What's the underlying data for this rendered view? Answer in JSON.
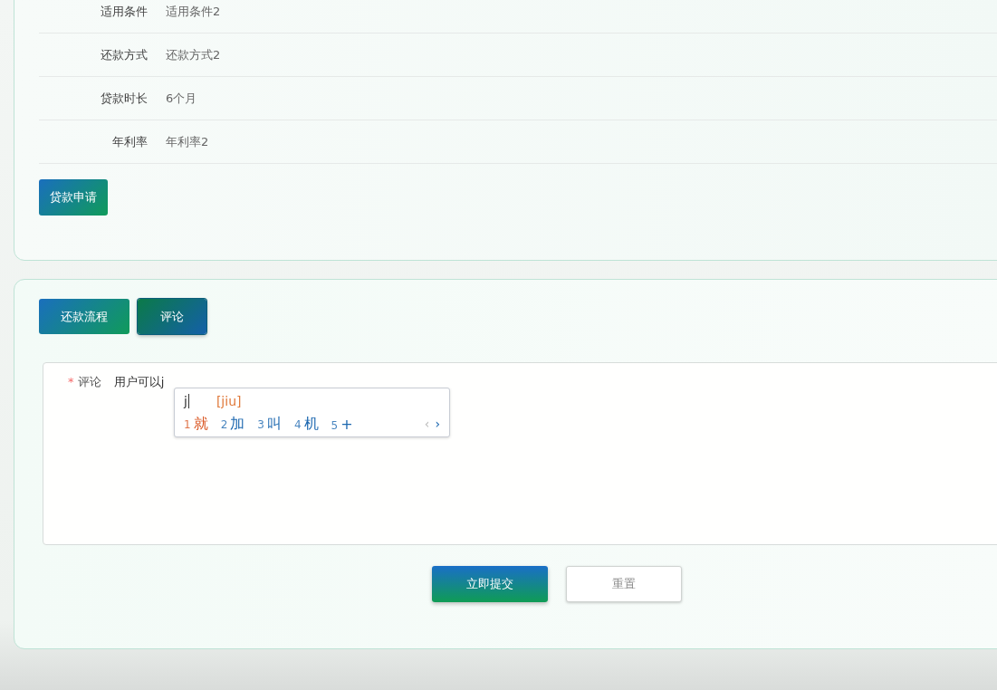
{
  "details": [
    {
      "label": "适用条件",
      "value": "适用条件2"
    },
    {
      "label": "还款方式",
      "value": "还款方式2"
    },
    {
      "label": "贷款时长",
      "value": "6个月"
    },
    {
      "label": "年利率",
      "value": "年利率2"
    }
  ],
  "apply_button": "贷款申请",
  "tabs": [
    {
      "label": "还款流程",
      "selected": false
    },
    {
      "label": "评论",
      "selected": true
    }
  ],
  "comment_form": {
    "label": "评论",
    "required_mark": "*",
    "value": "用户可以j"
  },
  "ime_popup": {
    "composition": "j",
    "pinyin": "[jiu]",
    "candidates": [
      {
        "number": "1",
        "text": "就",
        "selected": true
      },
      {
        "number": "2",
        "text": "加",
        "selected": false
      },
      {
        "number": "3",
        "text": "叫",
        "selected": false
      },
      {
        "number": "4",
        "text": "机",
        "selected": false
      },
      {
        "number": "5",
        "text": "+",
        "selected": false
      }
    ],
    "prev": "‹",
    "next": "›"
  },
  "buttons": {
    "submit": "立即提交",
    "reset": "重置"
  }
}
